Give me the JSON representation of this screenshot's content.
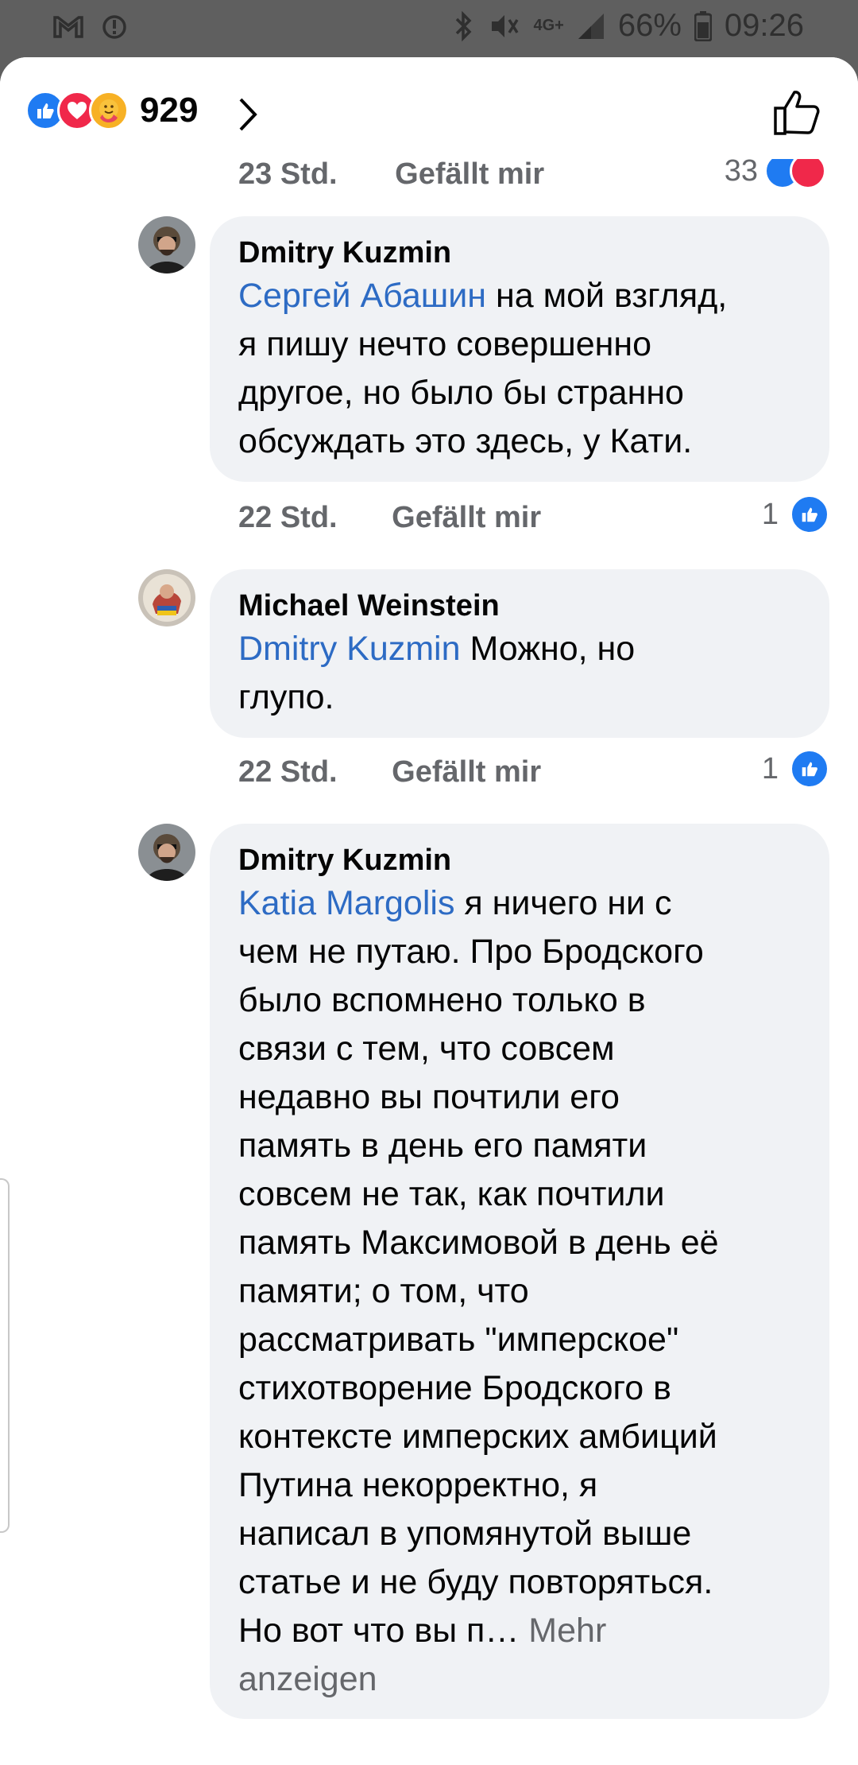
{
  "status_bar": {
    "network": "4G+",
    "battery": "66%",
    "time": "09:26"
  },
  "header": {
    "reaction_count": "929",
    "reactions": [
      "like",
      "love",
      "care"
    ]
  },
  "previous_comment": {
    "time": "23 Std.",
    "like_label": "Gefällt mir",
    "reaction_count": "33"
  },
  "comments": [
    {
      "author": "Dmitry Kuzmin",
      "mention": "Сергей Абашин",
      "lines": [
        " на мой взгляд,",
        "я пишу нечто совершенно",
        "другое, но было бы странно",
        "обсуждать это здесь, у Кати."
      ],
      "time": "22 Std.",
      "like_label": "Gefällt mir",
      "reaction_count": "1"
    },
    {
      "author": "Michael Weinstein",
      "mention": "Dmitry Kuzmin",
      "lines": [
        " Можно, но",
        "глупо."
      ],
      "time": "22 Std.",
      "like_label": "Gefällt mir",
      "reaction_count": "1"
    },
    {
      "author": "Dmitry Kuzmin",
      "mention": "Katia Margolis",
      "lines": [
        " я ничего ни с",
        "чем не путаю. Про Бродского",
        "было вспомнено только в",
        "связи с тем, что совсем",
        "недавно вы почтили его",
        "память в день его памяти",
        "совсем не так, как почтили",
        "память Максимовой в день её",
        "памяти; о том, что",
        "рассматривать \"имперское\"",
        "стихотворение Бродского в",
        "контексте имперских амбиций",
        "Путина некорректно, я",
        "написал в упомянутой выше",
        "статье и не буду повторяться.",
        "Но вот что вы п… "
      ],
      "more_label": "Mehr",
      "more_label_2": "anzeigen"
    }
  ],
  "colors": {
    "accent": "#1f7bf2",
    "mention": "#2d6bc4",
    "bubble": "#f0f2f5",
    "muted": "#65676b"
  }
}
